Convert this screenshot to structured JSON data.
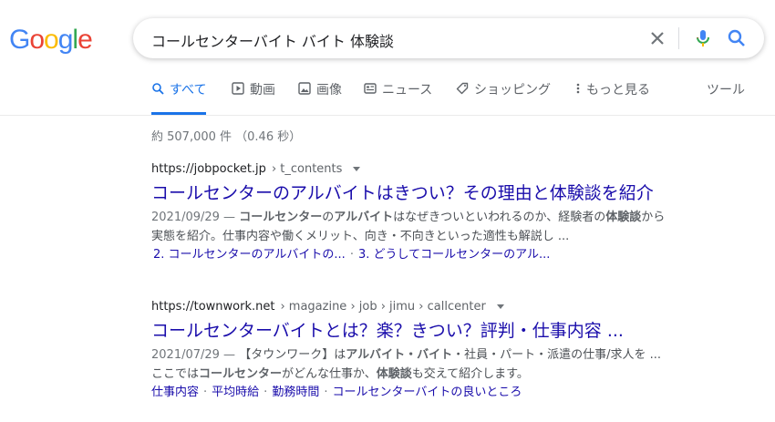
{
  "logo": {
    "g1": "G",
    "g2": "o",
    "g3": "o",
    "g4": "g",
    "g5": "l",
    "g6": "e"
  },
  "search": {
    "query": "コールセンターバイト バイト 体験談"
  },
  "tabs": [
    {
      "label": "すべて",
      "icon": "search-icon"
    },
    {
      "label": "動画",
      "icon": "video-icon"
    },
    {
      "label": "画像",
      "icon": "image-icon"
    },
    {
      "label": "ニュース",
      "icon": "news-icon"
    },
    {
      "label": "ショッピング",
      "icon": "tag-icon"
    },
    {
      "label": "もっと見る",
      "icon": "more-vert-icon"
    }
  ],
  "tools_label": "ツール",
  "stats": "約 507,000 件 （0.46 秒）",
  "results": [
    {
      "url_host": "https://jobpocket.jp",
      "url_path": "› t_contents",
      "title": "コールセンターのアルバイトはきつい？その理由と体験談を紹介",
      "date": "2021/09/29 — ",
      "snippet_parts": [
        "コールセンター",
        "の",
        "アルバイト",
        "はなぜきついといわれるのか、経験者の",
        "体験談",
        "から"
      ],
      "snippet_line2": "実態を紹介。仕事内容や働くメリット、向き・不向きといった適性も解説し ...",
      "sitelinks": [
        "2. コールセンターのアルバイトの...",
        "3. どうしてコールセンターのアル..."
      ]
    },
    {
      "url_host": "https://townwork.net",
      "url_path": "› magazine › job › jimu › callcenter",
      "title": "コールセンターバイトとは？楽？きつい？評判・仕事内容 ...",
      "date": "2021/07/29 — ",
      "snippet_parts": [
        "【タウンワーク】は",
        "アルバイト・バイト",
        "・社員・パート・派遣の仕事/求人を ..."
      ],
      "snippet_line2_parts": [
        "ここでは",
        "コールセンター",
        "がどんな仕事か、",
        "体験談",
        "も交えて紹介します。"
      ],
      "sitelinks": [
        "仕事内容",
        "平均時給",
        "勤務時間",
        "コールセンターバイトの良いところ"
      ]
    }
  ],
  "colors": {
    "link": "#1a0dab",
    "accent": "#1a73e8"
  }
}
